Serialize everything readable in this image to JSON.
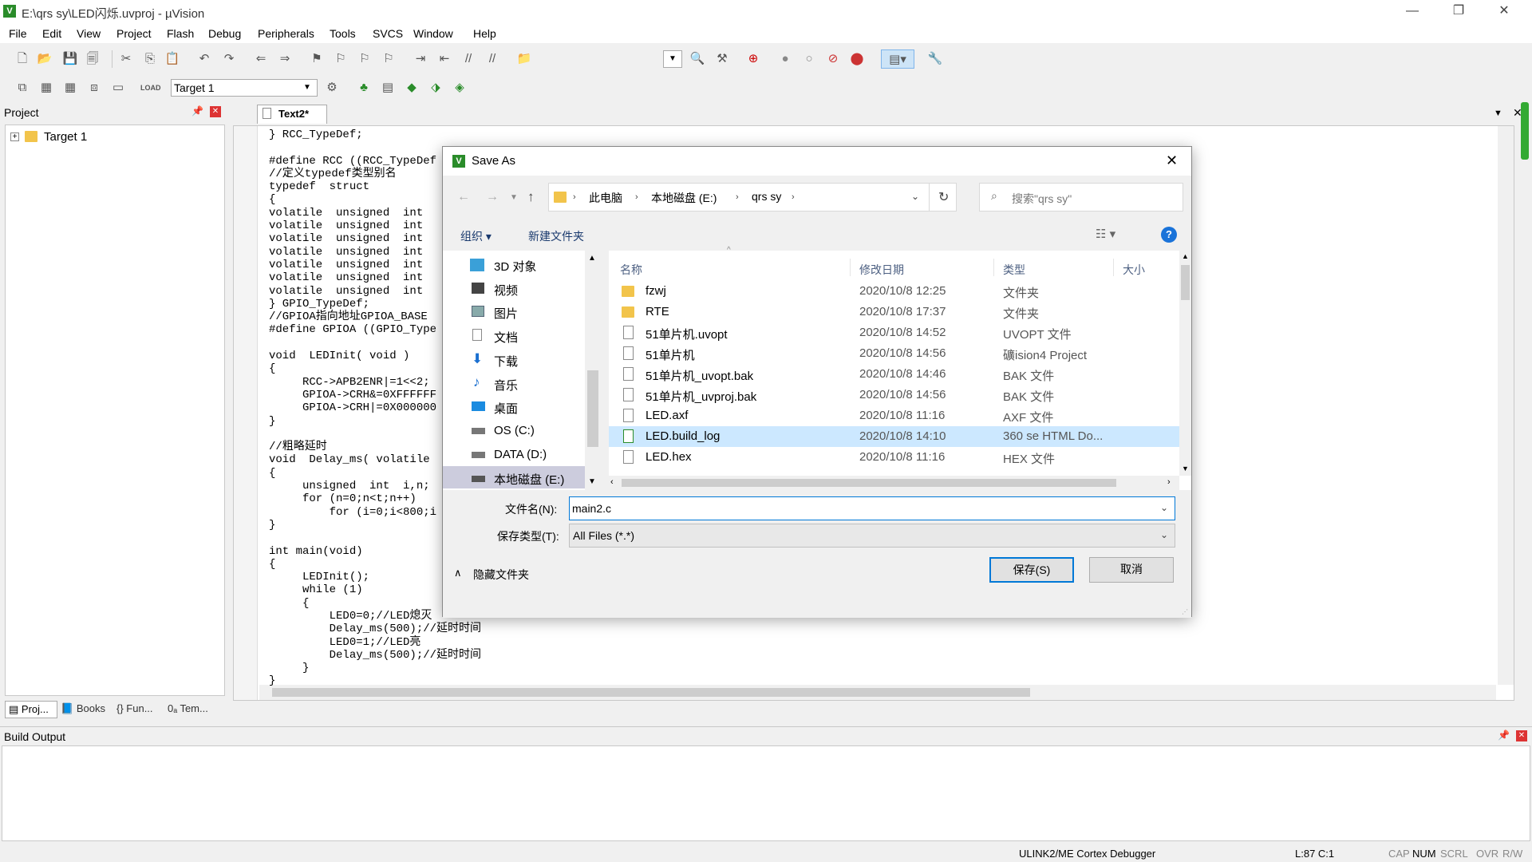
{
  "window": {
    "title": "E:\\qrs sy\\LED闪烁.uvproj - µVision",
    "app_icon": "keil-uvision-icon",
    "minimize": "—",
    "restore": "❐",
    "close": "✕"
  },
  "menu": [
    "File",
    "Edit",
    "View",
    "Project",
    "Flash",
    "Debug",
    "Peripherals",
    "Tools",
    "SVCS",
    "Window",
    "Help"
  ],
  "toolbar2": {
    "target": "Target 1"
  },
  "project_pane": {
    "title": "Project",
    "tree_item": "Target 1",
    "tabs": [
      "Proj...",
      "Books",
      "{} Fun...",
      "0ₐ Tem..."
    ]
  },
  "editor": {
    "tab": "Text2*",
    "code_lines": [
      "} RCC_TypeDef;",
      "",
      "#define RCC ((RCC_TypeDef",
      "//定义typedef类型别名",
      "typedef  struct",
      "{",
      "volatile  unsigned  int",
      "volatile  unsigned  int",
      "volatile  unsigned  int",
      "volatile  unsigned  int",
      "volatile  unsigned  int",
      "volatile  unsigned  int",
      "volatile  unsigned  int",
      "} GPIO_TypeDef;",
      "//GPIOA指向地址GPIOA_BASE",
      "#define GPIOA ((GPIO_Type",
      "",
      "void  LEDInit( void )",
      "{",
      "     RCC->APB2ENR|=1<<2;",
      "     GPIOA->CRH&=0XFFFFFF",
      "     GPIOA->CRH|=0X000000",
      "}",
      "",
      "//粗略延时",
      "void  Delay_ms( volatile",
      "{",
      "     unsigned  int  i,n;",
      "     for (n=0;n<t;n++)",
      "         for (i=0;i<800;i",
      "}",
      "",
      "int main(void)",
      "{",
      "     LEDInit();",
      "     while (1)",
      "     {",
      "         LED0=0;//LED熄灭",
      "         Delay_ms(500);//延时时间",
      "         LED0=1;//LED亮",
      "         Delay_ms(500);//延时时间",
      "     }",
      "}"
    ]
  },
  "build_output": {
    "title": "Build Output"
  },
  "status": {
    "debugger": "ULINK2/ME Cortex Debugger",
    "position": "L:87 C:1",
    "flags": [
      "CAP",
      "NUM",
      "SCRL",
      "OVR",
      "R/W"
    ]
  },
  "dialog": {
    "title": "Save As",
    "close": "✕",
    "breadcrumb": [
      "此电脑",
      "本地磁盘 (E:)",
      "qrs sy"
    ],
    "search_placeholder": "搜索\"qrs sy\"",
    "organize": "组织 ▾",
    "new_folder": "新建文件夹",
    "help": "?",
    "nav_items": [
      "3D 对象",
      "视频",
      "图片",
      "文档",
      "下载",
      "音乐",
      "桌面",
      "OS (C:)",
      "DATA (D:)",
      "本地磁盘 (E:)"
    ],
    "columns": {
      "name": "名称",
      "date": "修改日期",
      "type": "类型",
      "size": "大小"
    },
    "files": [
      {
        "name": "fzwj",
        "date": "2020/10/8 12:25",
        "type": "文件夹",
        "icon": "folder-icon"
      },
      {
        "name": "RTE",
        "date": "2020/10/8 17:37",
        "type": "文件夹",
        "icon": "folder-icon"
      },
      {
        "name": "51单片机.uvopt",
        "date": "2020/10/8 14:52",
        "type": "UVOPT 文件",
        "icon": "file-icon"
      },
      {
        "name": "51单片机",
        "date": "2020/10/8 14:56",
        "type": "礦ision4 Project",
        "icon": "file-icon"
      },
      {
        "name": "51单片机_uvopt.bak",
        "date": "2020/10/8 14:46",
        "type": "BAK 文件",
        "icon": "file-icon"
      },
      {
        "name": "51单片机_uvproj.bak",
        "date": "2020/10/8 14:56",
        "type": "BAK 文件",
        "icon": "file-icon"
      },
      {
        "name": "LED.axf",
        "date": "2020/10/8 11:16",
        "type": "AXF 文件",
        "icon": "file-icon"
      },
      {
        "name": "LED.build_log",
        "date": "2020/10/8 14:10",
        "type": "360 se HTML Do...",
        "icon": "html-file-icon"
      },
      {
        "name": "LED.hex",
        "date": "2020/10/8 11:16",
        "type": "HEX 文件",
        "icon": "file-icon"
      }
    ],
    "filename_label": "文件名(N):",
    "filename_value": "main2.c",
    "filetype_label": "保存类型(T):",
    "filetype_value": "All Files (*.*)",
    "hide_folders": "隐藏文件夹",
    "save": "保存(S)",
    "cancel": "取消"
  }
}
